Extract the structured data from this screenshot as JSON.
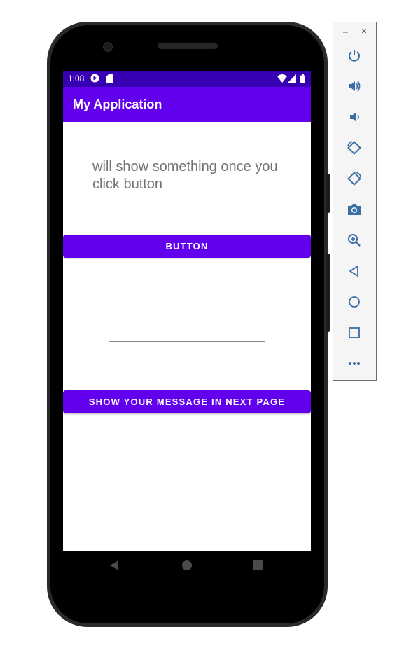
{
  "status_bar": {
    "time": "1:08"
  },
  "app_bar": {
    "title": "My Application"
  },
  "content": {
    "info_text": "will show something once you click button",
    "primary_button_label": "BUTTON",
    "message_input": {
      "value": "",
      "placeholder": ""
    },
    "next_page_button_label": "SHOW YOUR MESSAGE IN NEXT PAGE"
  },
  "nav_bar": {
    "icons": [
      "back-icon",
      "home-icon",
      "recents-icon"
    ]
  },
  "emulator_toolbar": {
    "window_controls": {
      "minimize": "–",
      "close": "×"
    },
    "buttons": [
      "power-icon",
      "volume-up-icon",
      "volume-down-icon",
      "rotate-left-icon",
      "rotate-right-icon",
      "screenshot-icon",
      "zoom-icon",
      "back-icon",
      "home-icon",
      "overview-icon",
      "more-icon"
    ]
  },
  "colors": {
    "primary": "#6200ee",
    "primary_dark": "#3700b3",
    "text_secondary": "#737373"
  }
}
